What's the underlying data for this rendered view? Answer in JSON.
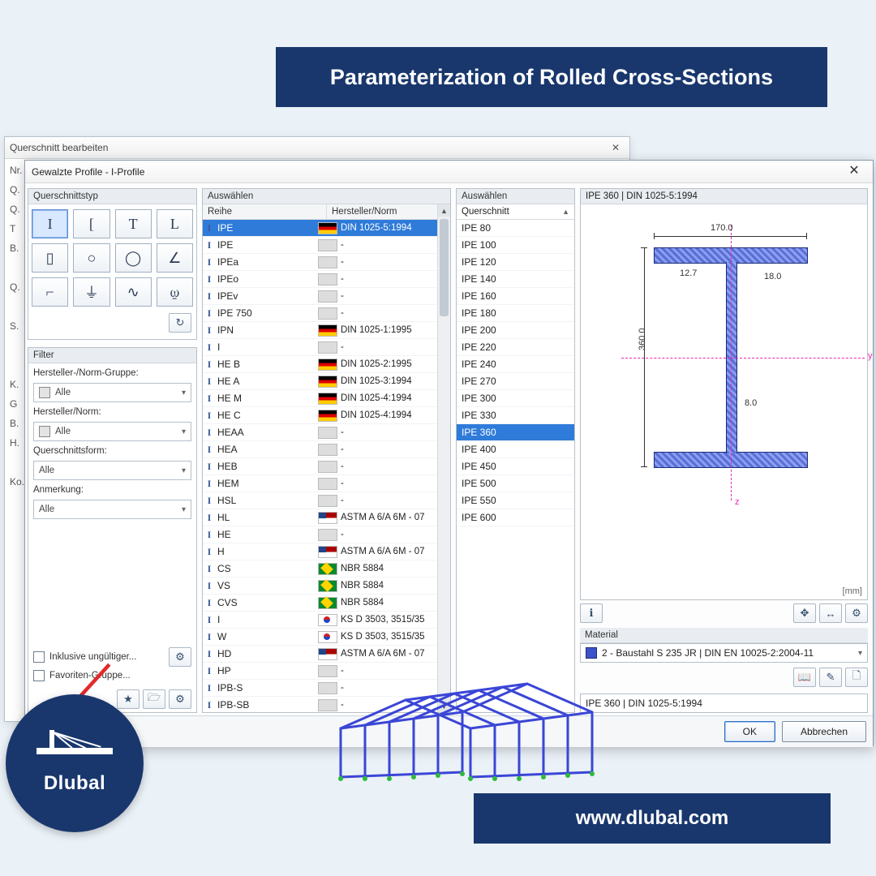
{
  "banner": "Parameterization of Rolled Cross-Sections",
  "url": "www.dlubal.com",
  "brand": "Dlubal",
  "bg_window": {
    "title": "Querschnitt bearbeiten",
    "side": [
      "Nr.",
      "Q.",
      "Q.",
      "T",
      "B.",
      "",
      "Q.",
      "",
      "S.",
      "",
      "",
      "K.",
      "G",
      "B.",
      "H.",
      "",
      "Ko."
    ]
  },
  "dialog": {
    "title": "Gewalzte Profile - I-Profile",
    "panel_type": "Querschnittstyp",
    "panel_filter": "Filter",
    "panel_reihe": "Auswählen",
    "panel_qs": "Auswählen",
    "panel_mat": "Material",
    "preview_title": "IPE 360 | DIN 1025-5:1994",
    "units": "[mm]",
    "col_reihe": "Reihe",
    "col_norm": "Hersteller/Norm",
    "col_qs": "Querschnitt",
    "filter": {
      "grp_label": "Hersteller-/Norm-Gruppe:",
      "norm_label": "Hersteller/Norm:",
      "form_label": "Querschnittsform:",
      "anm_label": "Anmerkung:",
      "all": "Alle",
      "chk1": "Inklusive ungültiger...",
      "chk2": "Favoriten-Gruppe..."
    },
    "material": "2 - Baustahl S 235 JR | DIN EN 10025-2:2004-11",
    "result_text": "IPE 360 | DIN 1025-5:1994",
    "ok": "OK",
    "cancel": "Abbrechen"
  },
  "types": [
    "I",
    "[",
    "T",
    "L",
    "▯",
    "○",
    "◯",
    "∠",
    "⌐",
    "⏚",
    "∿",
    "⍹"
  ],
  "reihe": [
    {
      "n": "IPE",
      "norm": "DIN 1025-5:1994",
      "flag": "de",
      "sel": true
    },
    {
      "n": "IPE",
      "norm": "-",
      "flag": "none"
    },
    {
      "n": "IPEa",
      "norm": "-",
      "flag": "none"
    },
    {
      "n": "IPEo",
      "norm": "-",
      "flag": "none"
    },
    {
      "n": "IPEv",
      "norm": "-",
      "flag": "none"
    },
    {
      "n": "IPE 750",
      "norm": "-",
      "flag": "none"
    },
    {
      "n": "IPN",
      "norm": "DIN 1025-1:1995",
      "flag": "de"
    },
    {
      "n": "I",
      "norm": "-",
      "flag": "none"
    },
    {
      "n": "HE B",
      "norm": "DIN 1025-2:1995",
      "flag": "de"
    },
    {
      "n": "HE A",
      "norm": "DIN 1025-3:1994",
      "flag": "de"
    },
    {
      "n": "HE M",
      "norm": "DIN 1025-4:1994",
      "flag": "de"
    },
    {
      "n": "HE C",
      "norm": "DIN 1025-4:1994",
      "flag": "de"
    },
    {
      "n": "HEAA",
      "norm": "-",
      "flag": "none"
    },
    {
      "n": "HEA",
      "norm": "-",
      "flag": "none"
    },
    {
      "n": "HEB",
      "norm": "-",
      "flag": "none"
    },
    {
      "n": "HEM",
      "norm": "-",
      "flag": "none"
    },
    {
      "n": "HSL",
      "norm": "-",
      "flag": "none"
    },
    {
      "n": "HL",
      "norm": "ASTM A 6/A 6M - 07",
      "flag": "us"
    },
    {
      "n": "HE",
      "norm": "-",
      "flag": "none"
    },
    {
      "n": "H",
      "norm": "ASTM A 6/A 6M - 07",
      "flag": "us"
    },
    {
      "n": "CS",
      "norm": "NBR 5884",
      "flag": "br"
    },
    {
      "n": "VS",
      "norm": "NBR 5884",
      "flag": "br"
    },
    {
      "n": "CVS",
      "norm": "NBR 5884",
      "flag": "br"
    },
    {
      "n": "I",
      "norm": "KS D 3503, 3515/35",
      "flag": "kr"
    },
    {
      "n": "W",
      "norm": "KS D 3503, 3515/35",
      "flag": "kr"
    },
    {
      "n": "HD",
      "norm": "ASTM A 6/A 6M - 07",
      "flag": "us"
    },
    {
      "n": "HP",
      "norm": "-",
      "flag": "none"
    },
    {
      "n": "IPB-S",
      "norm": "-",
      "flag": "none"
    },
    {
      "n": "IPB-SB",
      "norm": "-",
      "flag": "none"
    }
  ],
  "qs": [
    "IPE 80",
    "IPE 100",
    "IPE 120",
    "IPE 140",
    "IPE 160",
    "IPE 180",
    "IPE 200",
    "IPE 220",
    "IPE 240",
    "IPE 270",
    "IPE 300",
    "IPE 330",
    "IPE 360",
    "IPE 400",
    "IPE 450",
    "IPE 500",
    "IPE 550",
    "IPE 600"
  ],
  "qs_selected": "IPE 360",
  "dims": {
    "b": "170.0",
    "h": "360.0",
    "tf": "12.7",
    "r": "18.0",
    "tw": "8.0",
    "y": "y",
    "z": "z"
  }
}
